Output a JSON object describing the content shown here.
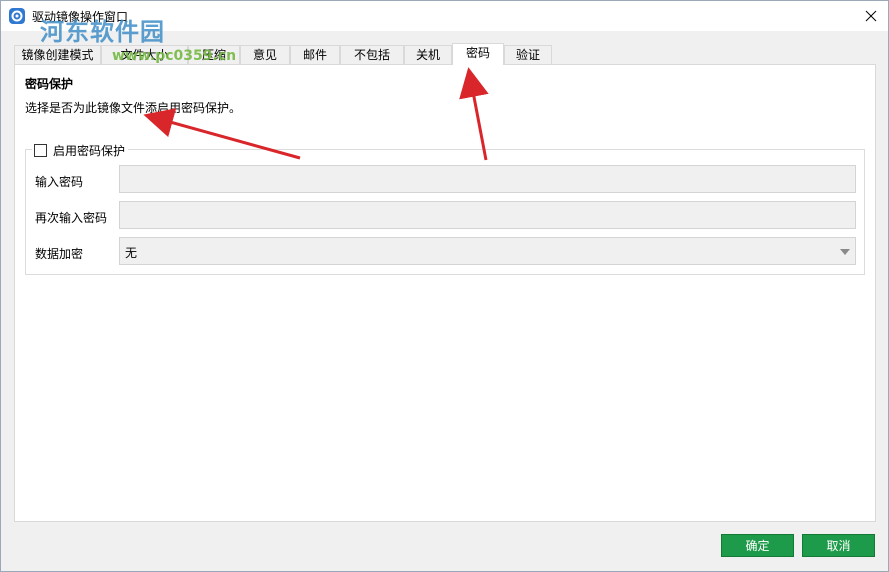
{
  "window": {
    "title": "驱动镜像操作窗口",
    "close_glyph": "✕"
  },
  "watermark": {
    "text": "河东软件园",
    "url": "www.pc0359.cn"
  },
  "tabs": [
    {
      "label": "镜像创建模式",
      "active": false
    },
    {
      "label": "文件大小",
      "active": false
    },
    {
      "label": "压缩",
      "active": false
    },
    {
      "label": "意见",
      "active": false
    },
    {
      "label": "邮件",
      "active": false
    },
    {
      "label": "不包括",
      "active": false
    },
    {
      "label": "关机",
      "active": false
    },
    {
      "label": "密码",
      "active": true
    },
    {
      "label": "验证",
      "active": false
    }
  ],
  "password_panel": {
    "title": "密码保护",
    "description": "选择是否为此镜像文件添启用密码保护。",
    "enable_checkbox": {
      "label": "启用密码保护",
      "checked": false
    },
    "fields": {
      "enter_password": {
        "label": "输入密码",
        "value": ""
      },
      "confirm_password": {
        "label": "再次输入密码",
        "value": ""
      },
      "data_encryption": {
        "label": "数据加密",
        "value": "无"
      }
    }
  },
  "buttons": {
    "ok": "确定",
    "cancel": "取消"
  },
  "colors": {
    "button_green": "#1e9b4a",
    "annotation_red": "#d9262b",
    "watermark_blue": "#3f8ec7",
    "watermark_green": "#74b842"
  },
  "icons": {
    "app": "app-logo-icon",
    "close": "close-icon",
    "dropdown": "chevron-down-icon",
    "checkbox": "checkbox-icon"
  }
}
